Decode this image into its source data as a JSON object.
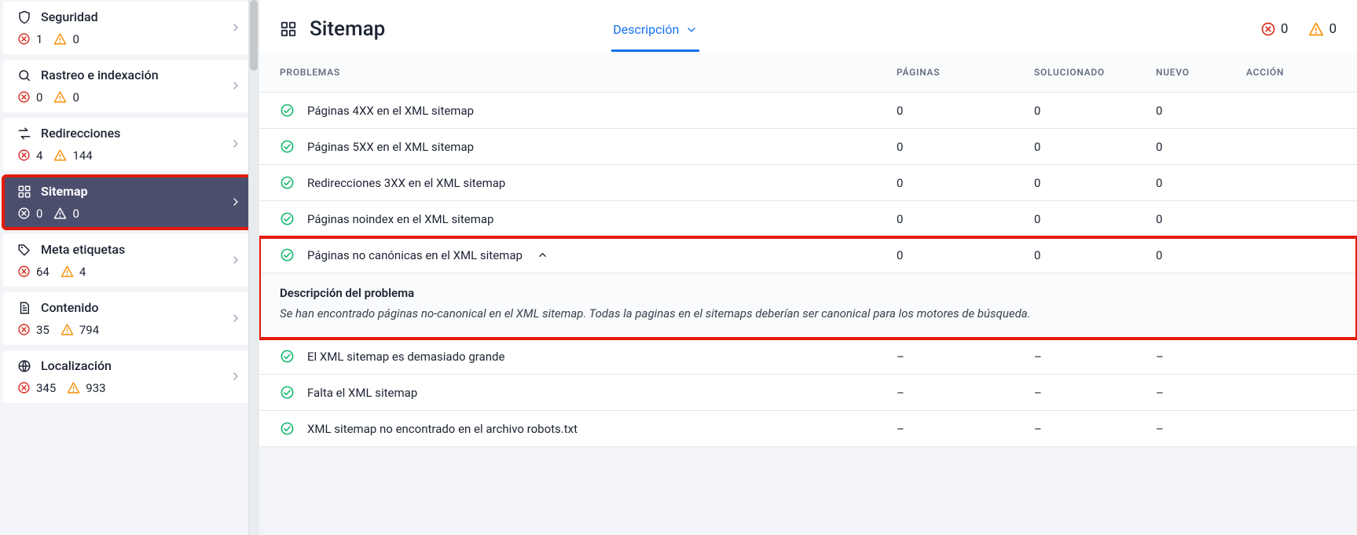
{
  "sidebar": {
    "items": [
      {
        "key": "seguridad",
        "label": "Seguridad",
        "errors": "1",
        "warnings": "0",
        "icon": "shield"
      },
      {
        "key": "rastreo",
        "label": "Rastreo e indexación",
        "errors": "0",
        "warnings": "0",
        "icon": "search"
      },
      {
        "key": "redirecciones",
        "label": "Redirecciones",
        "errors": "4",
        "warnings": "144",
        "icon": "redirect"
      },
      {
        "key": "sitemap",
        "label": "Sitemap",
        "errors": "0",
        "warnings": "0",
        "icon": "grid",
        "active": true,
        "highlight": true
      },
      {
        "key": "meta",
        "label": "Meta etiquetas",
        "errors": "64",
        "warnings": "4",
        "icon": "tag"
      },
      {
        "key": "contenido",
        "label": "Contenido",
        "errors": "35",
        "warnings": "794",
        "icon": "doc"
      },
      {
        "key": "localizacion",
        "label": "Localización",
        "errors": "345",
        "warnings": "933",
        "icon": "globe"
      }
    ]
  },
  "header": {
    "title": "Sitemap",
    "tab_label": "Descripción",
    "err_count": "0",
    "warn_count": "0"
  },
  "table": {
    "headers": {
      "problems": "Problemas",
      "pages": "Páginas",
      "fixed": "Solucionado",
      "new": "Nuevo",
      "action": "Acción"
    },
    "rows": [
      {
        "label": "Páginas 4XX en el XML sitemap",
        "pages": "0",
        "fixed": "0",
        "new": "0"
      },
      {
        "label": "Páginas 5XX en el XML sitemap",
        "pages": "0",
        "fixed": "0",
        "new": "0"
      },
      {
        "label": "Redirecciones 3XX en el XML sitemap",
        "pages": "0",
        "fixed": "0",
        "new": "0"
      },
      {
        "label": "Páginas noindex en el XML sitemap",
        "pages": "0",
        "fixed": "0",
        "new": "0"
      },
      {
        "label": "Páginas no canónicas en el XML sitemap",
        "pages": "0",
        "fixed": "0",
        "new": "0",
        "expanded": true,
        "highlight": true
      },
      {
        "label": "El XML sitemap es demasiado grande",
        "pages": "–",
        "fixed": "–",
        "new": "–"
      },
      {
        "label": "Falta el XML sitemap",
        "pages": "–",
        "fixed": "–",
        "new": "–"
      },
      {
        "label": "XML sitemap no encontrado en el archivo robots.txt",
        "pages": "–",
        "fixed": "–",
        "new": "–"
      }
    ],
    "description": {
      "title": "Descripción del problema",
      "body": "Se han encontrado páginas no-canonical en el XML sitemap. Todas la paginas en el sitemaps deberían ser canonical para los motores de búsqueda."
    }
  }
}
